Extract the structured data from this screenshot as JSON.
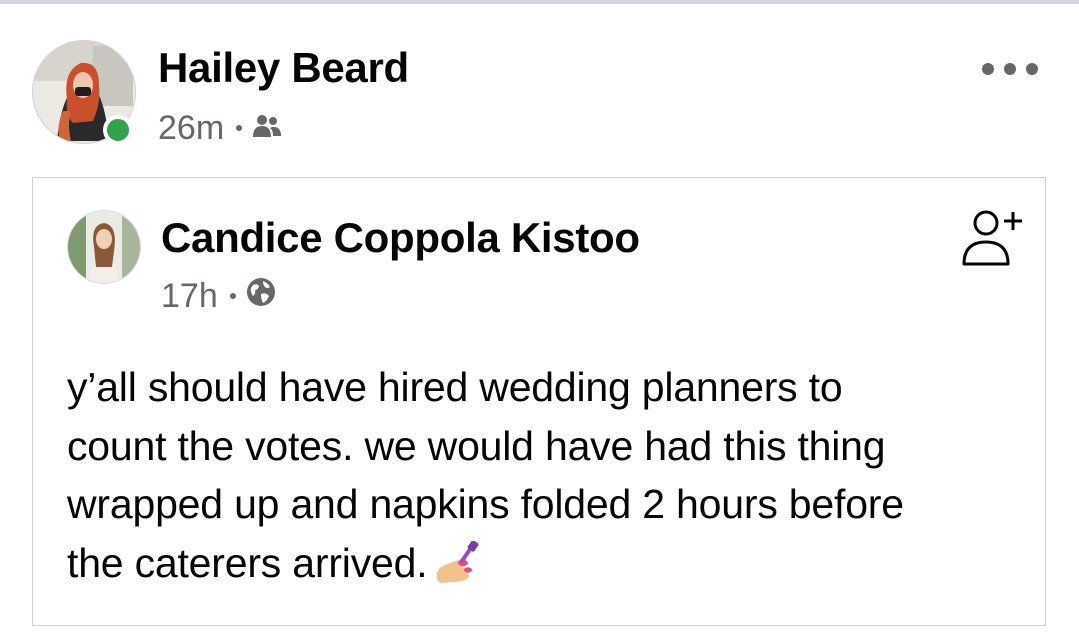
{
  "post": {
    "author": {
      "name": "Hailey Beard",
      "online": true
    },
    "time": "26m",
    "audience_icon": "friends-icon",
    "more_icon": "more-dots-icon"
  },
  "shared_post": {
    "author": {
      "name": "Candice Coppola Kistoo"
    },
    "time": "17h",
    "audience_icon": "globe-icon",
    "action_icon": "add-friend-icon",
    "text_lines": [
      "y’all should have hired wedding planners to",
      "count the votes. we would have had this thing",
      "wrapped up and napkins folded 2 hours before",
      "the caterers arrived."
    ],
    "emoji": "nail-polish-emoji"
  },
  "colors": {
    "online": "#31a24c",
    "meta_text": "#65676b",
    "card_border": "#ced0d4",
    "top_line": "#d4d4dc"
  }
}
